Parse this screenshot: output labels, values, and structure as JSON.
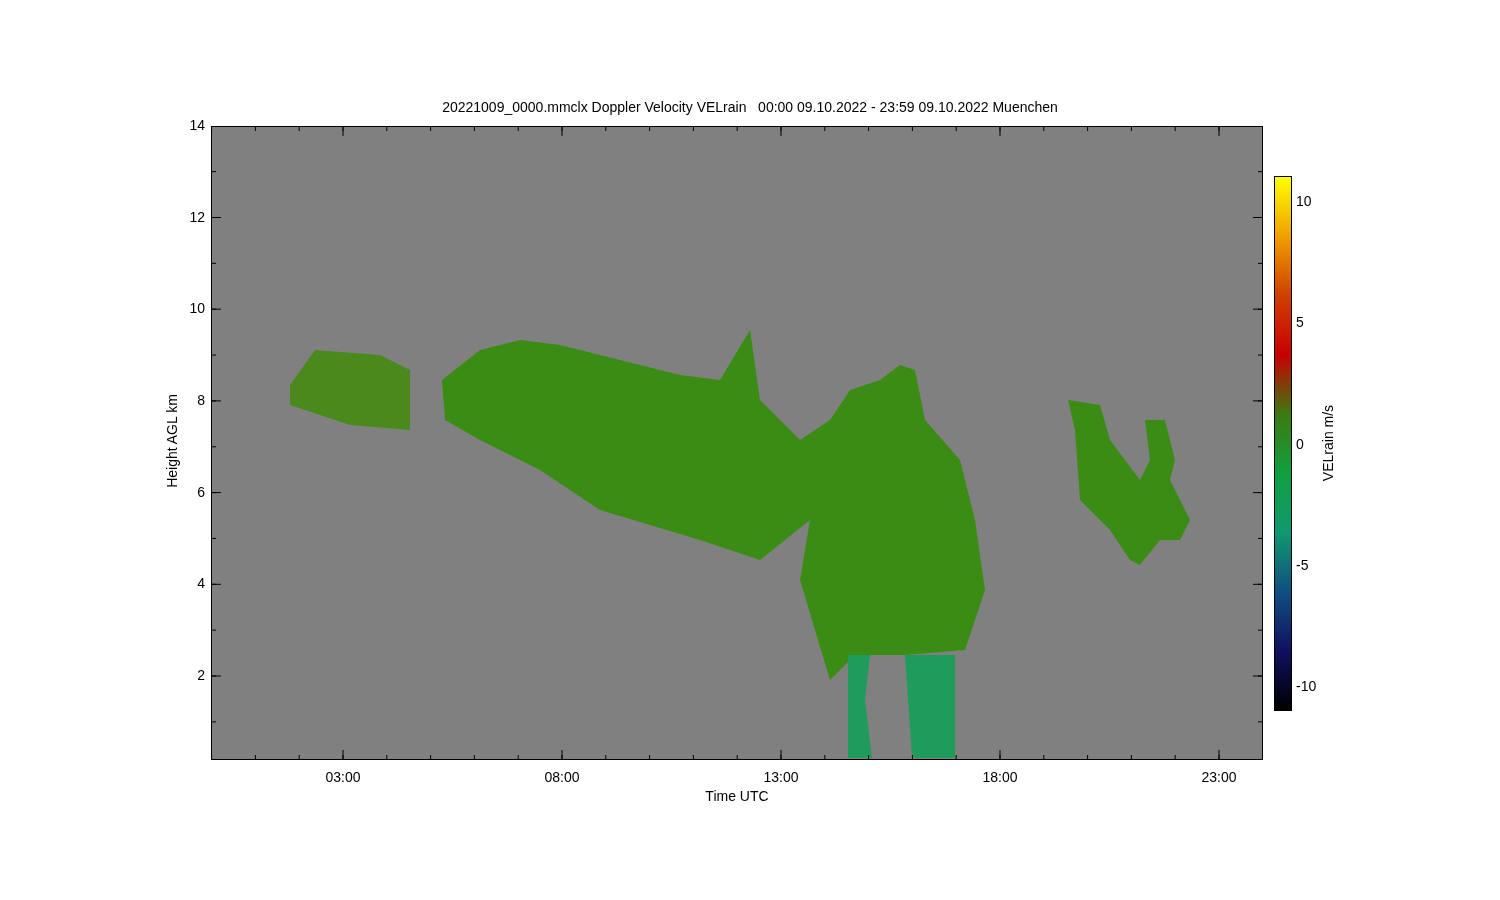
{
  "title": "20221009_0000.mmclx Doppler Velocity VELrain   00:00 09.10.2022 - 23:59 09.10.2022 Muenchen",
  "plot": {
    "xlabel": "Time UTC",
    "ylabel": "Height AGL km",
    "xticks": [
      "03:00",
      "08:00",
      "13:00",
      "18:00",
      "23:00"
    ],
    "yticks": [
      "14",
      "12",
      "10",
      "8",
      "6",
      "4",
      "2"
    ]
  },
  "colorbar": {
    "label": "VELrain m/s",
    "ticks": [
      "10",
      "5",
      "0",
      "-5",
      "-10"
    ]
  }
}
